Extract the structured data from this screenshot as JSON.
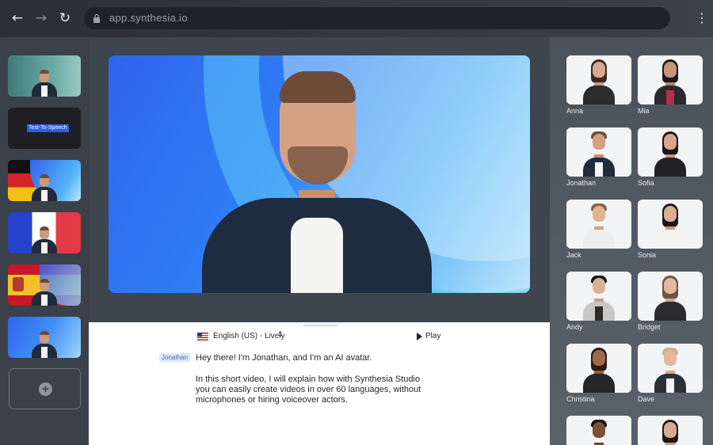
{
  "browser": {
    "url": "app.synthesia.io",
    "icons": [
      "back-arrow-icon",
      "forward-arrow-icon",
      "reload-icon",
      "lock-icon",
      "more-vertical-icon"
    ]
  },
  "slides": [
    {
      "kind": "avatar",
      "theme": "teal"
    },
    {
      "kind": "text",
      "label": "Text-To-Speech"
    },
    {
      "kind": "avatar",
      "theme": "germany"
    },
    {
      "kind": "avatar",
      "theme": "france"
    },
    {
      "kind": "avatar",
      "theme": "spain"
    },
    {
      "kind": "avatar",
      "theme": "blue"
    }
  ],
  "editor": {
    "language": "English (US) - Lively",
    "play_label": "Play",
    "speaker": "Jonathan",
    "script": [
      "Hey there! I'm Jonathan, and I'm an AI avatar.",
      "In this short video, I will explain how with Synthesia Studio",
      "you can easily create videos in over 60 languages, without",
      "microphones or hiring voiceover actors."
    ]
  },
  "avatars": [
    {
      "name": "Anna"
    },
    {
      "name": "Mia"
    },
    {
      "name": "Jonathan"
    },
    {
      "name": "Sofia"
    },
    {
      "name": "Jack"
    },
    {
      "name": "Sonia"
    },
    {
      "name": "Andy"
    },
    {
      "name": "Bridget"
    },
    {
      "name": "Christina"
    },
    {
      "name": "Dave"
    },
    {
      "name": ""
    },
    {
      "name": ""
    }
  ],
  "colors": {
    "accent": "#2f5be6",
    "canvas_blue": "#2f7ef5",
    "speaker_tag_bg": "#dce7fb"
  }
}
